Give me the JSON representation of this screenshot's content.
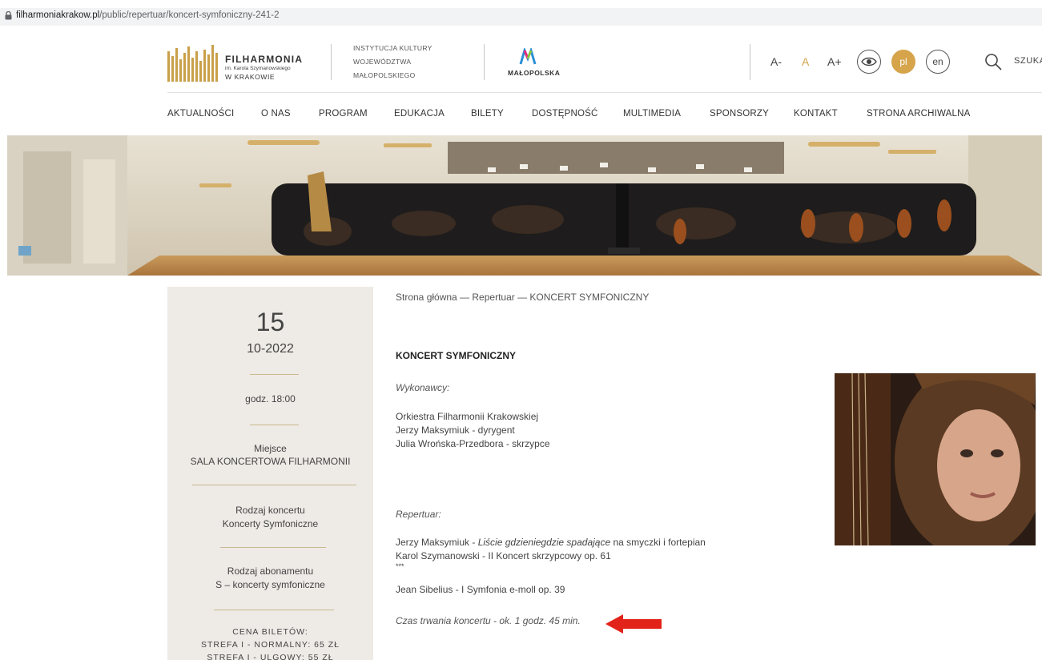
{
  "browser": {
    "url_host": "filharmoniakrakow.pl",
    "url_path": "/public/repertuar/koncert-symfoniczny-241-2"
  },
  "header": {
    "logo_name": "FILHARMONIA",
    "logo_sub": "im. Karola Szymanowskiego",
    "logo_city": "W KRAKOWIE",
    "institution_lines": [
      "INSTYTUCJA KULTURY",
      "WOJEWÓDZTWA",
      "MAŁOPOLSKIEGO"
    ],
    "partner": "MAŁOPOLSKA",
    "font_small": "A-",
    "font_normal": "A",
    "font_large": "A+",
    "lang_pl": "pl",
    "lang_en": "en",
    "search_label": "SZUKA"
  },
  "nav": [
    "AKTUALNOŚCI",
    "O NAS",
    "PROGRAM",
    "EDUKACJA",
    "BILETY",
    "DOSTĘPNOŚĆ",
    "MULTIMEDIA",
    "SPONSORZY",
    "KONTAKT",
    "STRONA ARCHIWALNA"
  ],
  "event": {
    "day": "15",
    "month_year": "10-2022",
    "time": "godz. 18:00",
    "place_label": "Miejsce",
    "place_value": "SALA KONCERTOWA FILHARMONII",
    "type_label": "Rodzaj koncertu",
    "type_value": "Koncerty Symfoniczne",
    "subscription_label": "Rodzaj abonamentu",
    "subscription_value": "S – koncerty symfoniczne",
    "prices_label": "CENA BILETÓW:",
    "price_1": "STREFA I - NORMALNY: 65 ZŁ",
    "price_2": "STREFA I - ULGOWY: 55 ZŁ"
  },
  "content": {
    "breadcrumb": "Strona główna  —  Repertuar  —  KONCERT SYMFONICZNY",
    "title": "KONCERT SYMFONICZNY",
    "performers_label": "Wykonawcy:",
    "performers": [
      "Orkiestra Filharmonii Krakowskiej",
      "Jerzy Maksymiuk - dyrygent",
      "Julia Wrońska-Przedbora - skrzypce"
    ],
    "repertoire_label": "Repertuar:",
    "rep_1_composer": "Jerzy Maksymiuk - ",
    "rep_1_title": "Liście gdzieniegdzie spadające",
    "rep_1_suffix": " na smyczki i fortepian",
    "rep_2": "Karol Szymanowski - II Koncert skrzypcowy op. 61",
    "rep_ellipsis": "***",
    "rep_3": "Jean Sibelius - I Symfonia e-moll op. 39",
    "duration": "Czas trwania koncertu - ok. 1 godz. 45 min."
  },
  "colors": {
    "gold": "#d6a44a",
    "sidebar_bg": "#eeeae6",
    "arrow_red": "#e2231a"
  }
}
